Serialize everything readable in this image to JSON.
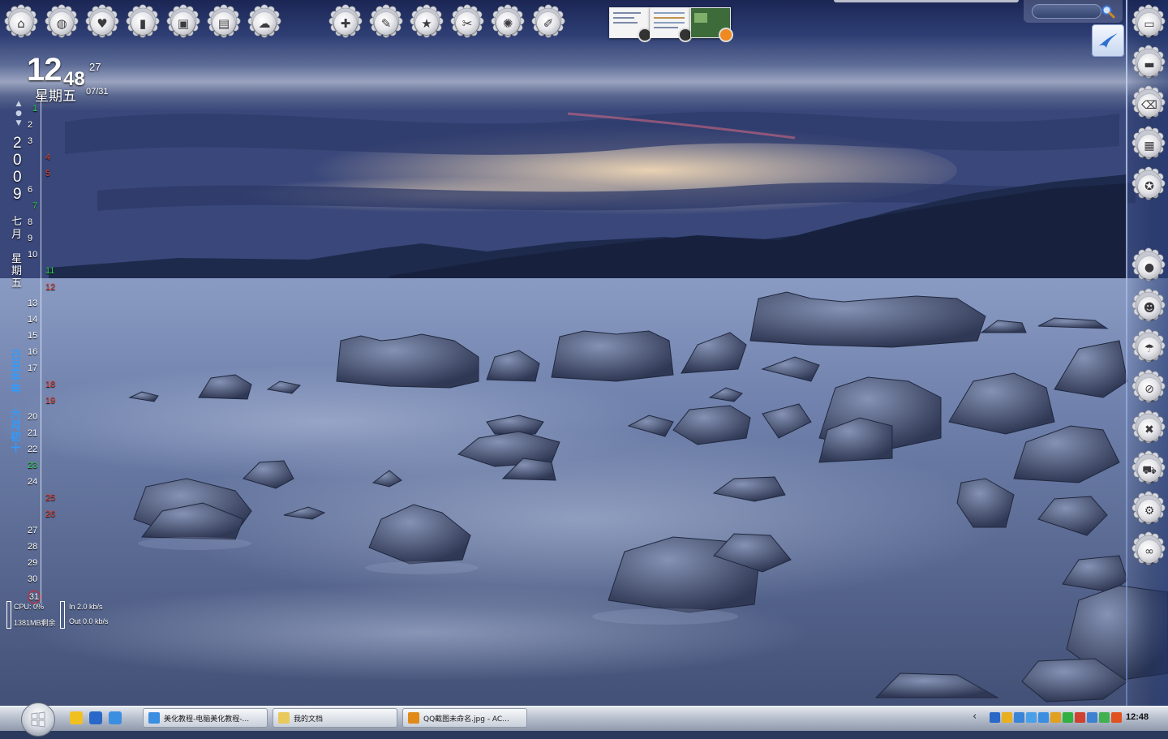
{
  "desktop": {
    "wallpaper": "lake-rocks-dusk",
    "colors": {
      "sky_top": "#1f2c5a",
      "sky_mid": "#5b6d9a",
      "sunset": "#e7c9a0",
      "water": "#8293b9",
      "rock": "#3e4863"
    }
  },
  "top_dock": {
    "icons": [
      {
        "name": "home-icon",
        "glyph": "⌂"
      },
      {
        "name": "globe-icon",
        "glyph": "◍"
      },
      {
        "name": "heart-icon",
        "glyph": "♥"
      },
      {
        "name": "bar-chart-icon",
        "glyph": "▮"
      },
      {
        "name": "ipod-icon",
        "glyph": "▣"
      },
      {
        "name": "document-icon",
        "glyph": "▤"
      },
      {
        "name": "speech-bubble-icon",
        "glyph": "☁"
      },
      {
        "name": "puzzle-icon",
        "glyph": "✚"
      },
      {
        "name": "pencil-icon",
        "glyph": "✎"
      },
      {
        "name": "star-icon",
        "glyph": "★"
      },
      {
        "name": "scissors-icon",
        "glyph": "✂"
      },
      {
        "name": "badge-icon",
        "glyph": "✺"
      },
      {
        "name": "pin-icon",
        "glyph": "✐"
      }
    ]
  },
  "side_dock": {
    "icons": [
      {
        "name": "monitor-icon",
        "glyph": "▭"
      },
      {
        "name": "folder-icon",
        "glyph": "▬"
      },
      {
        "name": "trash-icon",
        "glyph": "⌫"
      },
      {
        "name": "calculator-icon",
        "glyph": "▦"
      },
      {
        "name": "award-icon",
        "glyph": "✪"
      },
      {
        "name": "lightbulb-icon",
        "glyph": "●"
      },
      {
        "name": "users-icon",
        "glyph": "☻"
      },
      {
        "name": "umbrella-icon",
        "glyph": "☂"
      },
      {
        "name": "no-entry-icon",
        "glyph": "⊘"
      },
      {
        "name": "close-icon",
        "glyph": "✖"
      },
      {
        "name": "cart-icon",
        "glyph": "⛟"
      },
      {
        "name": "settings-icon",
        "glyph": "⚙"
      },
      {
        "name": "binoculars-icon",
        "glyph": "∞"
      }
    ]
  },
  "search": {
    "placeholder": ""
  },
  "clock": {
    "hour": "12",
    "minute": "48",
    "second": "27",
    "weekday": "星期五",
    "date": "07/31"
  },
  "calendar": {
    "nav": "▲\n●\n▼",
    "year_digits": [
      "2",
      "0",
      "0",
      "9"
    ],
    "month_chars": [
      "七",
      "月"
    ],
    "weekday_chars": [
      "星",
      "期",
      "五"
    ],
    "lunar_year_chars": [
      "己",
      "丑",
      "牛",
      "年"
    ],
    "lunar_day_chars": [
      "六",
      "月",
      "初",
      "十"
    ],
    "days": [
      {
        "d": "1",
        "k": "g"
      },
      {
        "d": "2",
        "k": "w"
      },
      {
        "d": "3",
        "k": "w"
      },
      {
        "d": "4",
        "k": "r"
      },
      {
        "d": "5",
        "k": "r"
      },
      {
        "d": "6",
        "k": "w"
      },
      {
        "d": "7",
        "k": "g"
      },
      {
        "d": "8",
        "k": "w"
      },
      {
        "d": "9",
        "k": "w"
      },
      {
        "d": "10",
        "k": "w"
      },
      {
        "d": "11",
        "k": "g"
      },
      {
        "d": "12",
        "k": "r"
      },
      {
        "d": "13",
        "k": "w"
      },
      {
        "d": "14",
        "k": "w"
      },
      {
        "d": "15",
        "k": "w"
      },
      {
        "d": "16",
        "k": "w"
      },
      {
        "d": "17",
        "k": "w"
      },
      {
        "d": "18",
        "k": "r"
      },
      {
        "d": "19",
        "k": "r"
      },
      {
        "d": "20",
        "k": "w"
      },
      {
        "d": "21",
        "k": "w"
      },
      {
        "d": "22",
        "k": "w"
      },
      {
        "d": "23",
        "k": "g"
      },
      {
        "d": "24",
        "k": "w"
      },
      {
        "d": "25",
        "k": "r"
      },
      {
        "d": "26",
        "k": "r"
      },
      {
        "d": "27",
        "k": "w"
      },
      {
        "d": "28",
        "k": "w"
      },
      {
        "d": "29",
        "k": "w"
      },
      {
        "d": "30",
        "k": "w"
      },
      {
        "d": "31",
        "k": "today"
      }
    ],
    "colors": {
      "w": "#ffffff",
      "r": "#e0402f",
      "g": "#2ed24a",
      "today_ring": "#e02020"
    }
  },
  "monitor": {
    "cpu": "CPU: 0%",
    "mem": "1381MB剩余",
    "net_in": "In   2.0 kb/s",
    "net_out": "Out 0.0 kb/s"
  },
  "thumbnails": [
    {
      "name": "window-thumbnail-1"
    },
    {
      "name": "window-thumbnail-2"
    },
    {
      "name": "window-thumbnail-3"
    }
  ],
  "taskbar": {
    "quick_launch": [
      {
        "name": "v-app-icon",
        "color": "#f0c020"
      },
      {
        "name": "show-desktop-icon",
        "color": "#2a68c8"
      },
      {
        "name": "ie-icon",
        "color": "#3c8ee0"
      }
    ],
    "tasks": [
      {
        "label": "美化教程-电脑美化教程-...",
        "icon": "#3c8ee0"
      },
      {
        "label": "我的文档",
        "icon": "#e8c95a"
      },
      {
        "label": "QQ截图未命名.jpg - AC...",
        "icon": "#e08a1a"
      }
    ],
    "tray": [
      {
        "name": "tray-qq-icon",
        "color": "#2a68c8"
      },
      {
        "name": "tray-penguin-icon",
        "color": "#e8b020"
      },
      {
        "name": "tray-network-icon",
        "color": "#3a84d8"
      },
      {
        "name": "tray-volume-icon",
        "color": "#4aa0e8"
      },
      {
        "name": "tray-ie-icon",
        "color": "#3c8ee0"
      },
      {
        "name": "tray-shield-icon",
        "color": "#e0a020"
      },
      {
        "name": "tray-green-icon",
        "color": "#30b040"
      },
      {
        "name": "tray-security-icon",
        "color": "#d04030"
      },
      {
        "name": "tray-cloud-icon",
        "color": "#4080d0"
      },
      {
        "name": "tray-antivirus-icon",
        "color": "#40b050"
      },
      {
        "name": "tray-ime-icon",
        "color": "#e05020"
      }
    ],
    "expand": "‹",
    "clock": "12:48"
  }
}
